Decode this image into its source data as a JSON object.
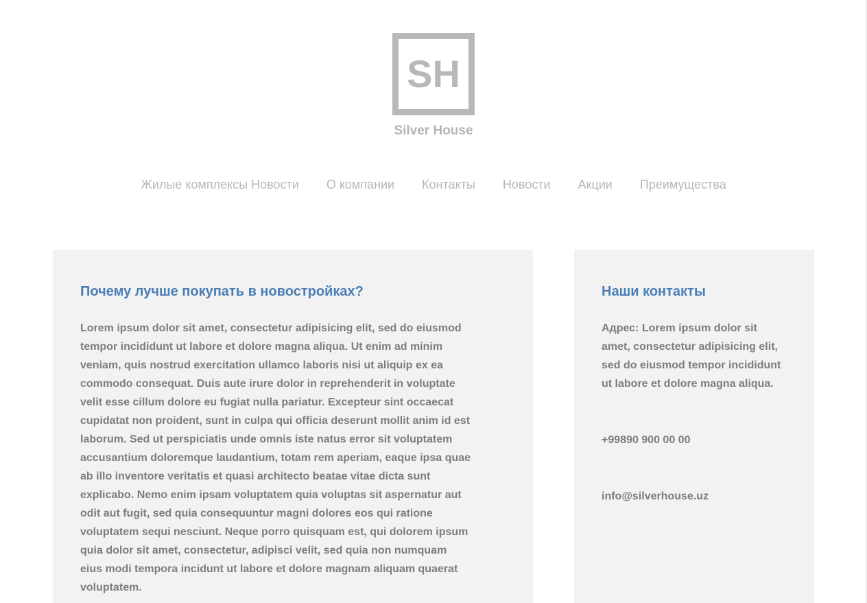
{
  "brand": {
    "logo_letters": "SH",
    "name": "Silver House"
  },
  "nav": {
    "items": [
      "Жилые комплексы Новости",
      "О компании",
      "Контакты",
      "Новости",
      "Акции",
      "Преимущества"
    ]
  },
  "main": {
    "title": "Почему лучше покупать в новостройках?",
    "body": "Lorem ipsum dolor sit amet, consectetur adipisicing elit, sed do eiusmod tempor incididunt ut labore et dolore magna aliqua. Ut enim ad minim veniam, quis nostrud exercitation ullamco laboris nisi ut aliquip ex ea commodo consequat. Duis aute irure dolor in reprehenderit in voluptate velit esse cillum dolore eu fugiat nulla pariatur. Excepteur sint occaecat cupidatat non proident, sunt in culpa qui officia deserunt mollit anim id est laborum. Sed ut perspiciatis unde omnis iste natus error sit voluptatem accusantium doloremque laudantium, totam rem aperiam, eaque ipsa quae ab illo inventore veritatis et quasi architecto beatae vitae dicta sunt explicabo. Nemo enim ipsam voluptatem quia voluptas sit aspernatur aut odit aut fugit, sed quia consequuntur magni dolores eos qui ratione voluptatem sequi nesciunt. Neque porro quisquam est, qui dolorem ipsum quia dolor sit amet, consectetur, adipisci velit, sed quia non numquam eius modi tempora incidunt ut labore et dolore magnam aliquam quaerat voluptatem."
  },
  "contacts": {
    "title": "Наши контакты",
    "address": "Адрес: Lorem ipsum dolor sit amet, consectetur adipisicing elit, sed do eiusmod tempor incididunt ut labore et dolore magna aliqua.",
    "phone": "+99890 900 00 00",
    "email": "info@silverhouse.uz"
  },
  "colors": {
    "accent": "#4a7eb6",
    "logo_gray": "#b8b8b8",
    "text_gray": "#7d7d7d",
    "panel_bg": "#f2f2f2"
  }
}
